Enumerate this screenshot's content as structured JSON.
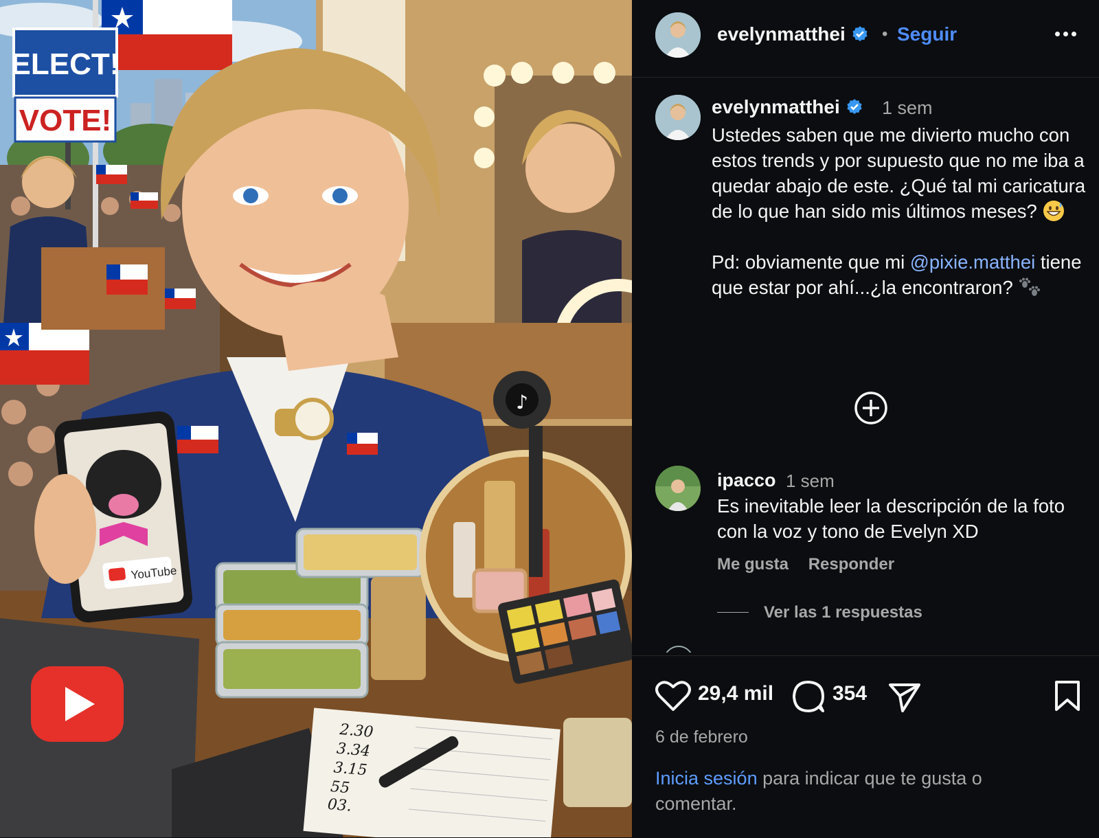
{
  "post": {
    "username": "evelynmatthei",
    "follow_label": "Seguir",
    "separator": "•"
  },
  "image": {
    "sign_elect": "ELECT!",
    "sign_vote": "VOTE!",
    "youtube_label": "YouTube",
    "notebook_values": [
      "2.30",
      "3.34",
      "3.15",
      "55",
      "03."
    ]
  },
  "caption": {
    "username": "evelynmatthei",
    "time": "1 sem",
    "text_part1": "Ustedes saben que me divierto mucho con estos trends y por supuesto que no me iba a quedar abajo de este. ¿Qué tal mi caricatura de lo que han sido mis últimos meses? ",
    "text_part2": "\n\nPd: obviamente que mi ",
    "mention": "@pixie.matthei",
    "text_part3": " tiene que estar por ahí...¿la encontraron? "
  },
  "comment": {
    "username": "ipacco",
    "time": "1 sem",
    "text": "Es inevitable leer la descripción de la foto con la voz y tono de Evelyn XD",
    "like_label": "Me gusta",
    "reply_label": "Responder",
    "view_replies": "Ver las 1 respuestas"
  },
  "footer": {
    "likes": "29,4 mil",
    "comments": "354",
    "date": "6 de febrero",
    "login_link": "Inicia sesión",
    "login_text": " para indicar que te gusta o comentar."
  },
  "colors": {
    "accent_blue": "#4f8dfd",
    "verified_blue": "#3897f0",
    "panel_bg": "#0b0d10"
  }
}
